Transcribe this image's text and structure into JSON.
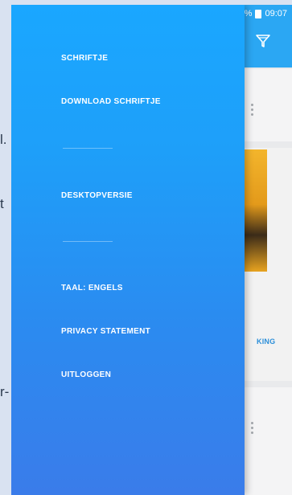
{
  "status_bar": {
    "battery": "90%",
    "time": "09:07"
  },
  "drawer": {
    "items": [
      {
        "label": "SCHRIFTJE"
      },
      {
        "label": "DOWNLOAD SCHRIFTJE"
      },
      {
        "label": "DESKTOPVERSIE"
      },
      {
        "label": "TAAL: ENGELS"
      },
      {
        "label": "PRIVACY STATEMENT"
      },
      {
        "label": "UITLOGGEN"
      }
    ]
  },
  "background": {
    "link_fragment": "KING",
    "edge_fragments": [
      "l.",
      "t",
      "r-"
    ]
  },
  "colors": {
    "drawer_top": "#1aa7ff",
    "drawer_bottom": "#3a7cea",
    "header": "#2ba7f3"
  }
}
